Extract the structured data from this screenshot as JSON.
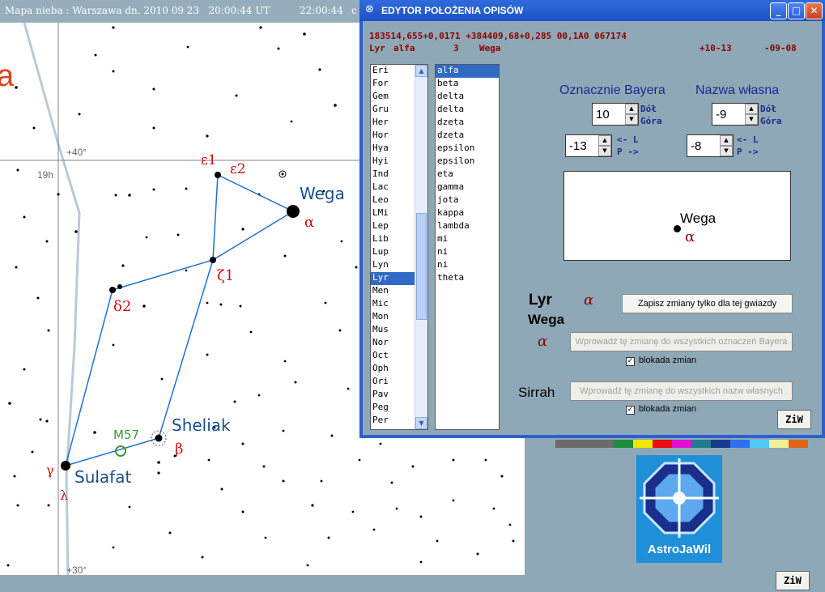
{
  "topbar": {
    "title": "Mapa nieba : Warszawa dn. 2010 09 23   20:00:44 UT",
    "local_time": "22:00:44",
    "trailing": "c"
  },
  "map": {
    "partial_label": "a",
    "grid": {
      "dec_top": "+40°",
      "dec_bottom": "+30°",
      "ra": "19h"
    },
    "stars": [
      {
        "name": "Wega",
        "greek": "α"
      },
      {
        "name": "",
        "greek": "ε1"
      },
      {
        "name": "",
        "greek": "ε2"
      },
      {
        "name": "",
        "greek": "ζ1"
      },
      {
        "name": "",
        "greek": "δ2"
      },
      {
        "name": "Sheliak",
        "greek": "β"
      },
      {
        "name": "Sulafat",
        "greek": "γ"
      },
      {
        "name": "",
        "greek": "λ"
      }
    ],
    "object": "M57",
    "colors": {
      "constellation_line": "#1f6fd0",
      "star_name": "#1a4e8c",
      "greek": "#cc1111",
      "m57": "#3a9a3a",
      "grid": "#808080",
      "milky_way": "#b9cbd6"
    }
  },
  "editor": {
    "title": "EDYTOR POŁOŻENIA OPISÓW",
    "info_line1": "183514,655+0,0171 +384409,68+0,285 00,1A0 067174",
    "info_line2": {
      "constellation": "Lyr",
      "greek": "alfa",
      "number": "3",
      "name": "Wega",
      "offset1": "+10-13",
      "offset2": "-09-08"
    },
    "constellations": [
      "Eri",
      "For",
      "Gem",
      "Gru",
      "Her",
      "Hor",
      "Hya",
      "Hyi",
      "Ind",
      "Lac",
      "Leo",
      "LMi",
      "Lep",
      "Lib",
      "Lup",
      "Lyn",
      "Lyr",
      "Men",
      "Mic",
      "Mon",
      "Mus",
      "Nor",
      "Oct",
      "Oph",
      "Ori",
      "Pav",
      "Peg",
      "Per"
    ],
    "selected_constellation": "Lyr",
    "greek_letters": [
      "alfa",
      "beta",
      "delta",
      "delta",
      "dzeta",
      "dzeta",
      "epsilon",
      "epsilon",
      "eta",
      "gamma",
      "jota",
      "kappa",
      "lambda",
      "mi",
      "ni",
      "ni",
      "theta"
    ],
    "selected_greek": "alfa",
    "bayer_header": "Oznacznie Bayera",
    "own_name_header": "Nazwa własna",
    "bayer_vertical": "10",
    "bayer_horizontal": "-13",
    "name_vertical": "-9",
    "name_horizontal": "-8",
    "label_down": "Dół",
    "label_up": "Góra",
    "label_left": "<- L",
    "label_right": "P ->",
    "preview": {
      "name": "Wega",
      "greek": "α"
    },
    "current_constellation": "Lyr",
    "current_greek": "α",
    "current_name": "Wega",
    "save_button": "Zapisz zmiany tylko dla tej gwiazdy",
    "apply_bayer_button": "Wprowadź tę zmianę do wszystkich oznaczeń Bayera",
    "apply_names_button": "Wprowadź tę zmianę do wszystkich nazw własnych",
    "lock_label": "blokada zmian",
    "lock_bayer_checked": "✓",
    "lock_names_checked": "✓",
    "greek_alpha": "α",
    "sirrah": "Sirrah",
    "ziw_label": "ZiW"
  },
  "palette": [
    "#6b6b6b",
    "#6b6b6b",
    "#6b6b6b",
    "#1e8c3c",
    "#f0e800",
    "#e81010",
    "#e010d0",
    "#1f7c8c",
    "#1a3a8c",
    "#3070f0",
    "#50c8f8",
    "#f0f098",
    "#e06418"
  ],
  "logo": {
    "text": "AstroJaWil"
  },
  "bottom_ziw": "ZiW"
}
